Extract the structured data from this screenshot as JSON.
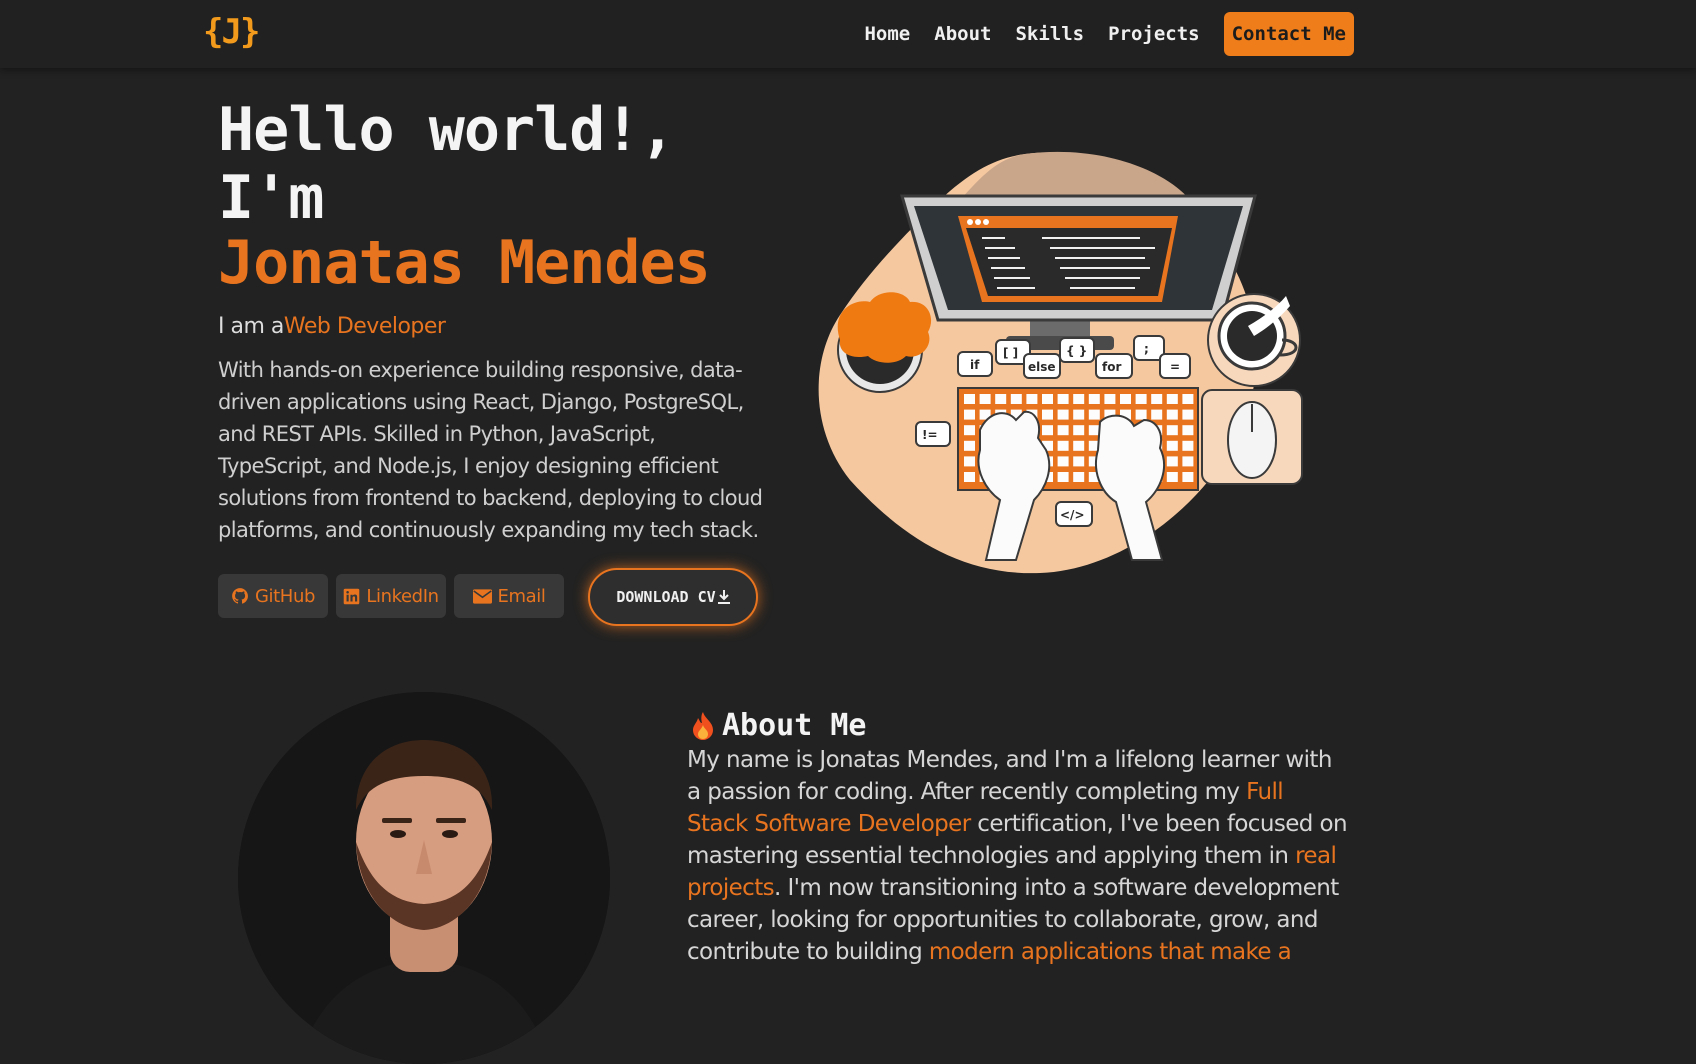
{
  "nav": {
    "logo": "{J}",
    "links": [
      "Home",
      "About",
      "Skills",
      "Projects"
    ],
    "contact": "Contact Me"
  },
  "hero": {
    "greeting_line1": "Hello world!,",
    "greeting_line2": "I'm",
    "name": "Jonatas Mendes",
    "role_prefix": "I am a",
    "role": "Web Developer",
    "bio": "With hands-on experience building responsive, data-driven applications using React, Django, PostgreSQL, and REST APIs. Skilled in Python, JavaScript, TypeScript, and Node.js, I enjoy designing efficient solutions from frontend to backend, deploying to cloud platforms, and continuously expanding my tech stack."
  },
  "social": {
    "github": "GitHub",
    "linkedin": "LinkedIn",
    "email": "Email"
  },
  "download": "DOWNLOAD CV",
  "illustration": {
    "bubbles": [
      "if",
      "[ ]",
      "else",
      "{ }",
      "for",
      ";",
      "=",
      "!=",
      "</>"
    ]
  },
  "about": {
    "title": "About Me",
    "p1": "My name is Jonatas Mendes, and I'm a lifelong learner with a passion for coding. After recently completing my ",
    "link1": "Full Stack Software Developer",
    "p2": " certification, I've been focused on mastering essential technologies and applying them in ",
    "link2": "real projects",
    "p3": ". I'm now transitioning into a software development career, looking for opportunities to collaborate, grow, and contribute to building ",
    "link3": "modern applications that make a"
  },
  "colors": {
    "background": "#222222",
    "accent": "#e8741f",
    "logo": "#f29a1c",
    "button_bg": "#383838"
  },
  "icons": [
    "github-icon",
    "linkedin-icon",
    "email-icon",
    "download-icon",
    "fire-icon"
  ]
}
